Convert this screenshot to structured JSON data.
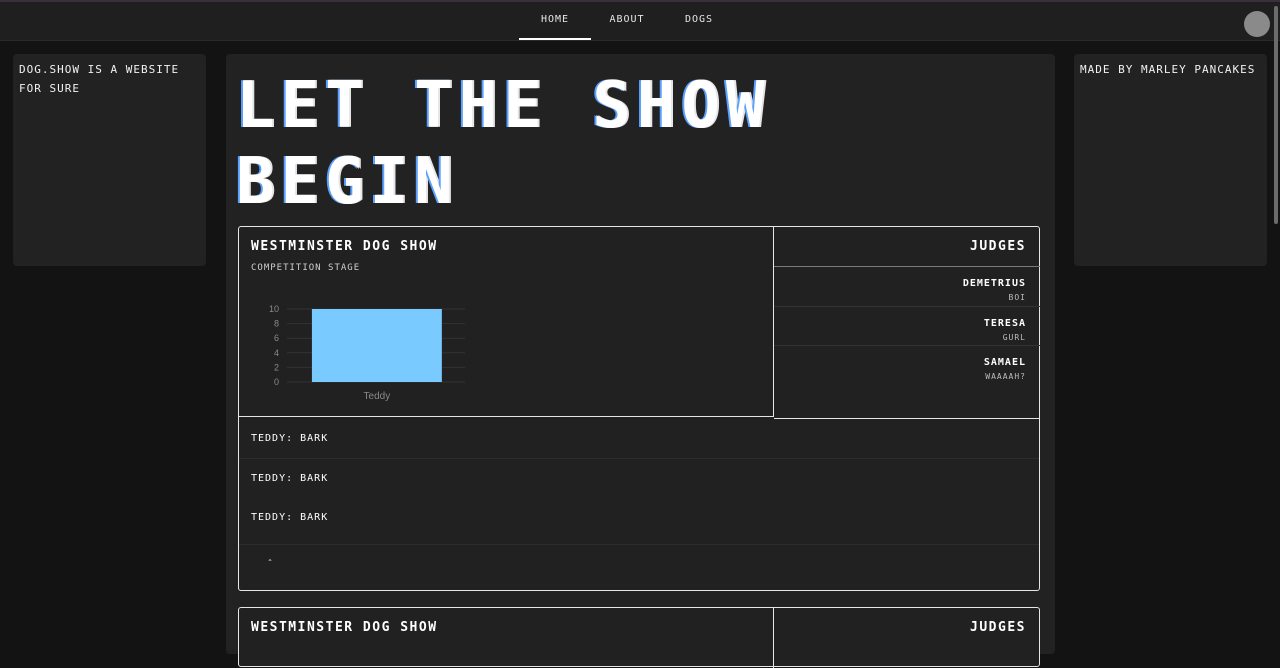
{
  "nav": {
    "items": [
      {
        "label": "Home",
        "active": true
      },
      {
        "label": "About",
        "active": false
      },
      {
        "label": "Dogs",
        "active": false
      }
    ]
  },
  "left_panel": {
    "text": "dog.show is a website for sure"
  },
  "right_panel": {
    "text": "Made by Marley Pancakes"
  },
  "hero": {
    "title": "LET THE SHOW BEGIN"
  },
  "cards": [
    {
      "title": "Westminster Dog Show",
      "subtitle": "Competition Stage",
      "judges_title": "Judges",
      "judges": [
        {
          "name": "Demetrius",
          "note": "boi"
        },
        {
          "name": "Teresa",
          "note": "gurl"
        },
        {
          "name": "Samael",
          "note": "waaaah?"
        }
      ],
      "messages": [
        "Teddy: bark",
        "Teddy: bark",
        "Teddy: bark"
      ],
      "collapse_symbol": "ˆ"
    },
    {
      "title": "Westminster Dog Show",
      "judges_title": "Judges"
    }
  ],
  "chart_data": {
    "type": "bar",
    "categories": [
      "Teddy"
    ],
    "values": [
      10
    ],
    "ylim": [
      0,
      10
    ],
    "yticks": [
      0,
      2,
      4,
      6,
      8,
      10
    ],
    "bar_color": "#79caff",
    "grid": true
  },
  "colors": {
    "page_bg": "#131313",
    "panel_bg": "#222222",
    "border": "#e6e6e6"
  }
}
